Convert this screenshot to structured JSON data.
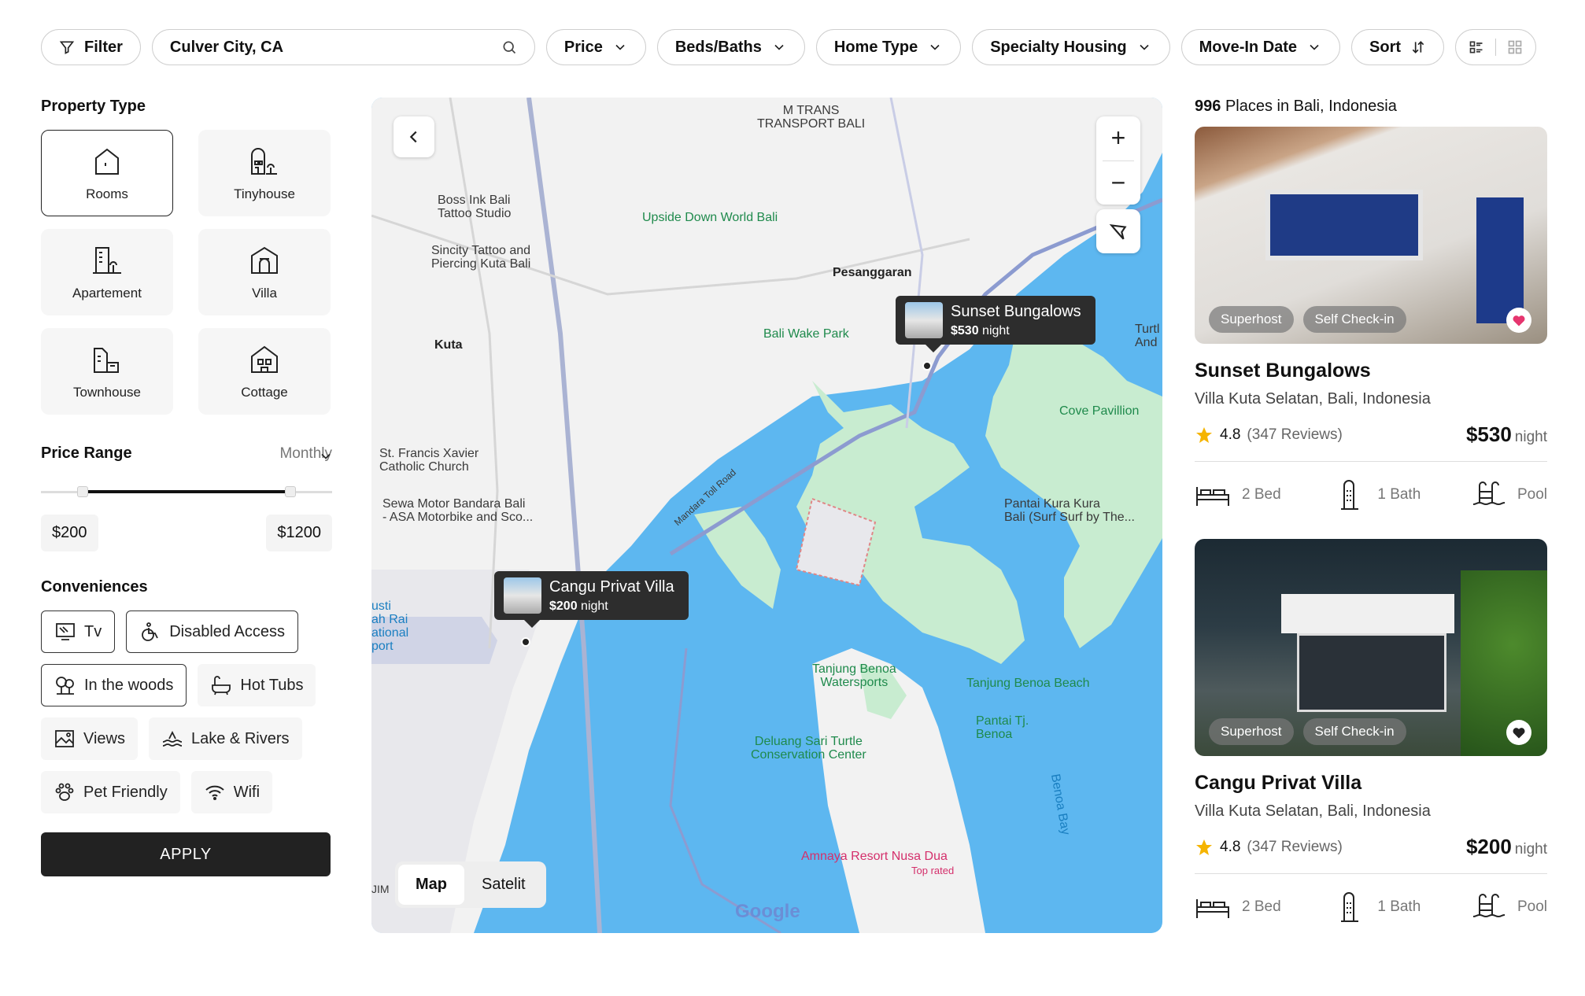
{
  "toolbar": {
    "filter_label": "Filter",
    "search_value": "Culver City, CA",
    "price_label": "Price",
    "beds_label": "Beds/Baths",
    "home_type_label": "Home Type",
    "specialty_label": "Specialty Housing",
    "move_in_label": "Move-In Date",
    "sort_label": "Sort"
  },
  "sidebar": {
    "property_type_heading": "Property Type",
    "property_types": [
      {
        "label": "Rooms",
        "icon": "house-icon",
        "selected": true
      },
      {
        "label": "Tinyhouse",
        "icon": "tinyhouse-icon",
        "selected": false
      },
      {
        "label": "Apartement",
        "icon": "apartment-icon",
        "selected": false
      },
      {
        "label": "Villa",
        "icon": "villa-icon",
        "selected": false
      },
      {
        "label": "Townhouse",
        "icon": "townhouse-icon",
        "selected": false
      },
      {
        "label": "Cottage",
        "icon": "cottage-icon",
        "selected": false
      }
    ],
    "price_range_heading": "Price Range",
    "price_period": "Monthly",
    "price_min": "$200",
    "price_max": "$1200",
    "conveniences_heading": "Conveniences",
    "conveniences": [
      {
        "label": "Tv",
        "icon": "tv-icon",
        "selected": true
      },
      {
        "label": "Disabled Access",
        "icon": "wheelchair-icon",
        "selected": true
      },
      {
        "label": "In the woods",
        "icon": "trees-icon",
        "selected": true
      },
      {
        "label": "Hot Tubs",
        "icon": "bathtub-icon",
        "selected": false
      },
      {
        "label": "Views",
        "icon": "image-icon",
        "selected": false
      },
      {
        "label": "Lake & Rivers",
        "icon": "waves-icon",
        "selected": false
      },
      {
        "label": "Pet Friendly",
        "icon": "paw-icon",
        "selected": false
      },
      {
        "label": "Wifi",
        "icon": "wifi-icon",
        "selected": false
      }
    ],
    "apply_label": "APPLY"
  },
  "map": {
    "labels": {
      "m_trans": "M TRANS\nTRANSPORT BALI",
      "boss_ink": "Boss Ink Bali\nTattoo Studio",
      "sincity": "Sincity Tattoo and\nPiercing Kuta Bali",
      "upside_down": "Upside Down World Bali",
      "pesanggaran": "Pesanggaran",
      "kuta": "Kuta",
      "bali_wake": "Bali Wake Park",
      "cove": "Cove Pavillion",
      "st_francis": "St. Francis Xavier\nCatholic Church",
      "sewa_motor": "Sewa Motor Bandara Bali\n- ASA Motorbike and Sco...",
      "pantai_kura": "Pantai Kura Kura\nBali (Surf Surf by The...",
      "airport": "usti\nah Rai\national\nport",
      "tanjung_ws": "Tanjung Benoa\nWatersports",
      "tanjung_beach": "Tanjung Benoa Beach",
      "pantai_tj": "Pantai Tj.\nBenoa",
      "deluang": "Deluang Sari Turtle\nConservation Center",
      "amnaya": "Amnaya Resort Nusa Dua",
      "top_rated": "Top rated",
      "benoa_bay": "Benoa Bay",
      "turtle_and": "Turtl\nAnd",
      "mandara_road": "Mandara Toll Road",
      "jim": "JIM",
      "google": "Google"
    },
    "tooltips": [
      {
        "name": "Sunset Bungalows",
        "price": "$530",
        "unit": "night"
      },
      {
        "name": "Cangu Privat Villa",
        "price": "$200",
        "unit": "night"
      }
    ],
    "view_map": "Map",
    "view_satellite": "Satelit"
  },
  "listings": {
    "count": "996",
    "location_text": "Places in Bali, Indonesia",
    "items": [
      {
        "title": "Sunset Bungalows",
        "address": "Villa Kuta Selatan, Bali, Indonesia",
        "rating": "4.8",
        "reviews": "(347 Reviews)",
        "price": "$530",
        "unit": "night",
        "badges": [
          "Superhost",
          "Self Check-in"
        ],
        "favorited": true,
        "beds": "2 Bed",
        "baths": "1 Bath",
        "pool": "Pool"
      },
      {
        "title": "Cangu Privat Villa",
        "address": "Villa Kuta Selatan, Bali, Indonesia",
        "rating": "4.8",
        "reviews": "(347 Reviews)",
        "price": "$200",
        "unit": "night",
        "badges": [
          "Superhost",
          "Self Check-in"
        ],
        "favorited": false,
        "beds": "2 Bed",
        "baths": "1 Bath",
        "pool": "Pool"
      }
    ]
  },
  "colors": {
    "accent_dark": "#222222",
    "water": "#5db7f0",
    "land": "#f2f2f2",
    "park": "#c8ecd0",
    "favorite": "#e6356f",
    "star": "#f5b400"
  }
}
